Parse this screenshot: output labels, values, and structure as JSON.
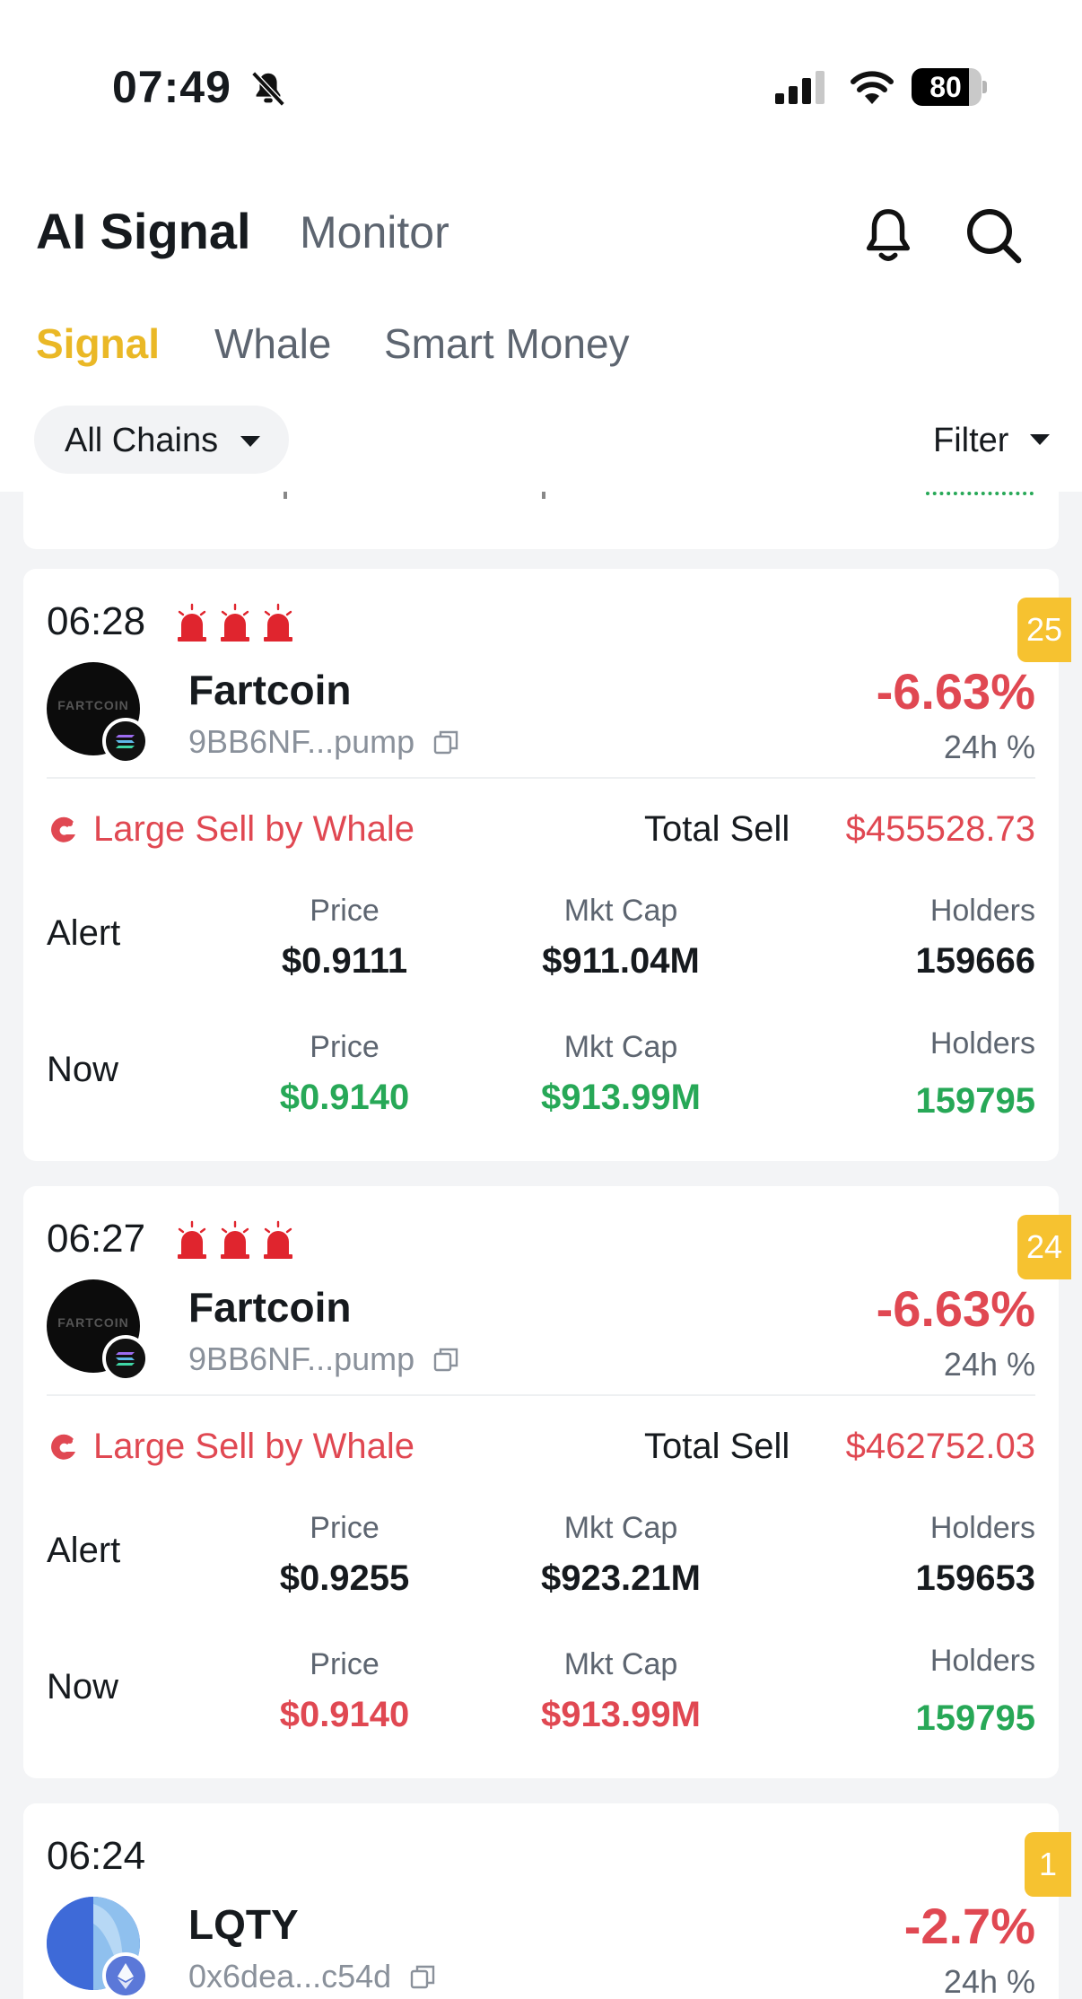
{
  "status_bar": {
    "time": "07:49",
    "battery": "80"
  },
  "header": {
    "title": "AI Signal",
    "monitor": "Monitor"
  },
  "tabs": [
    {
      "label": "Signal",
      "active": true
    },
    {
      "label": "Whale",
      "active": false
    },
    {
      "label": "Smart Money",
      "active": false
    }
  ],
  "filters": {
    "chains": "All Chains",
    "filter": "Filter"
  },
  "cards": [
    {
      "time": "06:28",
      "rank": "25",
      "token": "Fartcoin",
      "address": "9BB6NF...pump",
      "change": "-6.63%",
      "change_label": "24h %",
      "event": "Large Sell by Whale",
      "total_label": "Total Sell",
      "total_value": "$455528.73",
      "alert_label": "Alert",
      "now_label": "Now",
      "col_labels": {
        "price": "Price",
        "mkt_cap": "Mkt Cap",
        "holders": "Holders"
      },
      "alert": {
        "price": "$0.9111",
        "mkt_cap": "$911.04M",
        "holders": "159666"
      },
      "now": {
        "price": "$0.9140",
        "mkt_cap": "$913.99M",
        "holders": "159795",
        "price_color": "green",
        "mkt_cap_color": "green",
        "holders_color": "green"
      }
    },
    {
      "time": "06:27",
      "rank": "24",
      "token": "Fartcoin",
      "address": "9BB6NF...pump",
      "change": "-6.63%",
      "change_label": "24h %",
      "event": "Large Sell by Whale",
      "total_label": "Total Sell",
      "total_value": "$462752.03",
      "alert_label": "Alert",
      "now_label": "Now",
      "col_labels": {
        "price": "Price",
        "mkt_cap": "Mkt Cap",
        "holders": "Holders"
      },
      "alert": {
        "price": "$0.9255",
        "mkt_cap": "$923.21M",
        "holders": "159653"
      },
      "now": {
        "price": "$0.9140",
        "mkt_cap": "$913.99M",
        "holders": "159795",
        "price_color": "red",
        "mkt_cap_color": "red",
        "holders_color": "green"
      }
    },
    {
      "time": "06:24",
      "rank": "1",
      "token": "LQTY",
      "address": "0x6dea...c54d",
      "change": "-2.7%",
      "change_label": "24h %"
    }
  ],
  "colors": {
    "accent": "#eab826",
    "red": "#e04852",
    "green": "#27a857",
    "badge": "#f6c230"
  }
}
